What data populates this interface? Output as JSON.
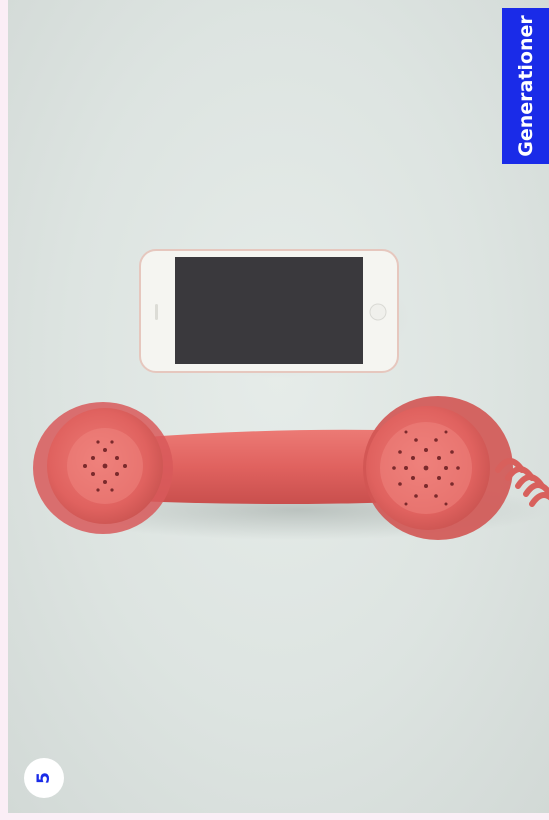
{
  "section_tag": {
    "label": "Generationer",
    "color": "#1a2be8"
  },
  "page_number": "5",
  "photo": {
    "subjects": [
      "smartphone-icon",
      "retro-telephone-handset-icon"
    ],
    "handset_color": "#e0625f",
    "background_color": "#e3e9e6"
  }
}
